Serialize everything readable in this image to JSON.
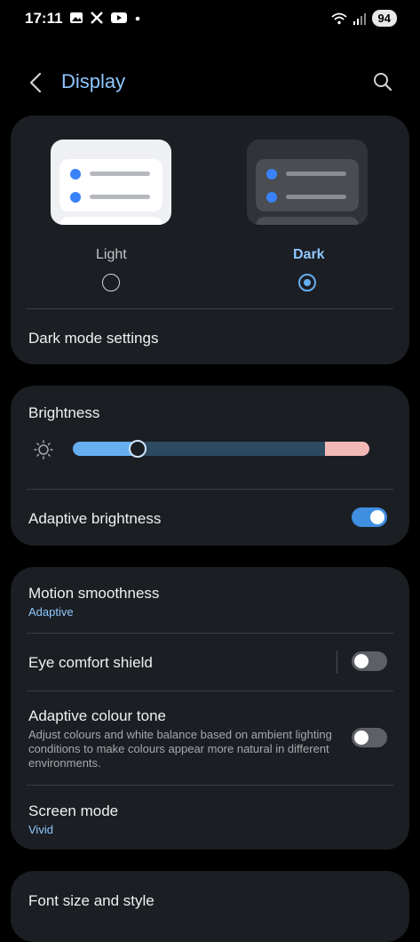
{
  "status_bar": {
    "time": "17:11",
    "battery": "94",
    "notification_icons": [
      "gallery-icon",
      "x-icon",
      "youtube-icon",
      "dot-icon"
    ],
    "system_icons": [
      "wifi-icon",
      "signal-icon"
    ]
  },
  "header": {
    "title": "Display",
    "back_icon": "chevron-left-icon",
    "search_icon": "search-icon"
  },
  "theme": {
    "light_label": "Light",
    "dark_label": "Dark",
    "selected": "Dark",
    "dark_mode_settings_label": "Dark mode settings"
  },
  "brightness": {
    "title": "Brightness",
    "level": 0.22,
    "adaptive_label": "Adaptive brightness",
    "adaptive_on": true
  },
  "motion": {
    "title": "Motion smoothness",
    "value": "Adaptive"
  },
  "eye_comfort": {
    "title": "Eye comfort shield",
    "on": false
  },
  "adaptive_colour": {
    "title": "Adaptive colour tone",
    "description": "Adjust colours and white balance based on ambient lighting conditions to make colours appear more natural in different environments.",
    "on": false
  },
  "screen_mode": {
    "title": "Screen mode",
    "value": "Vivid"
  },
  "font": {
    "title": "Font size and style"
  },
  "colors": {
    "accent": "#66aef0",
    "title_blue": "#8fc7ff",
    "card_bg": "#1b1e23"
  }
}
